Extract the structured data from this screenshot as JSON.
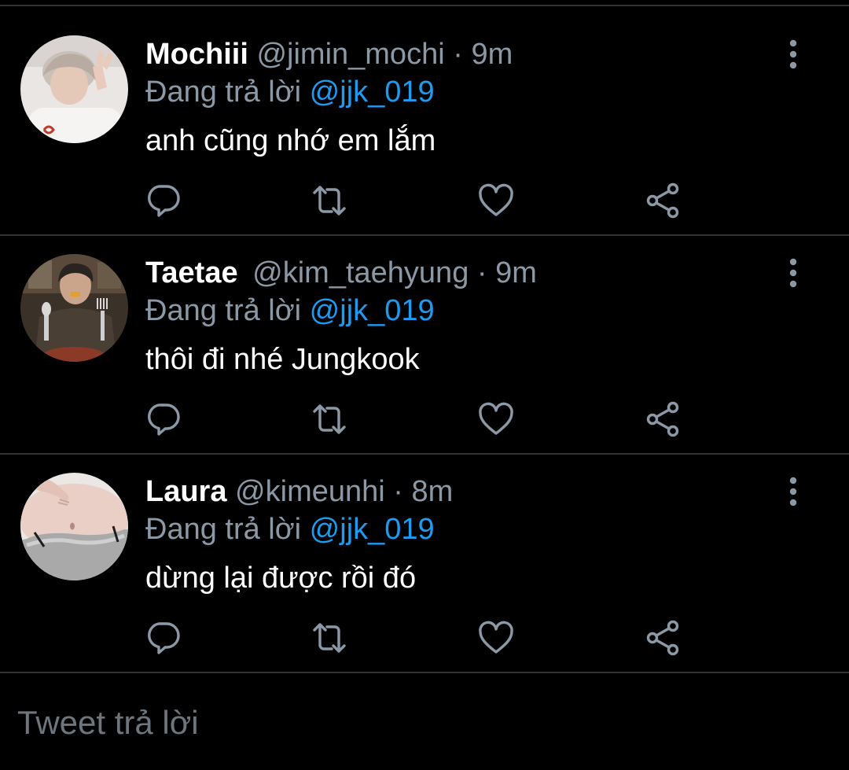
{
  "theme": {
    "background": "#000000",
    "divider": "#2f3336",
    "muted_text": "#8b98a5",
    "accent": "#1d9bf0",
    "primary_text": "#ffffff"
  },
  "tweets": [
    {
      "name": "Mochiii",
      "handle": "@jimin_mochi",
      "separator": "·",
      "time": "9m",
      "reply_prefix": "Đang trả lời",
      "reply_to": "@jjk_019",
      "text": "anh cũng nhớ em lắm",
      "avatar": "avatar-photo-peace-sign",
      "actions": [
        "reply-icon",
        "retweet-icon",
        "like-icon",
        "share-icon"
      ],
      "menu_icon": "more-vertical-icon"
    },
    {
      "name": "Taetae",
      "handle": "@kim_taehyung",
      "separator": "·",
      "time": "9m",
      "reply_prefix": "Đang trả lời",
      "reply_to": "@jjk_019",
      "text": "thôi đi nhé Jungkook",
      "avatar": "avatar-photo-fork-knife",
      "actions": [
        "reply-icon",
        "retweet-icon",
        "like-icon",
        "share-icon"
      ],
      "menu_icon": "more-vertical-icon"
    },
    {
      "name": "Laura",
      "handle": "@kimeunhi",
      "separator": "·",
      "time": "8m",
      "reply_prefix": "Đang trả lời",
      "reply_to": "@jjk_019",
      "text": "dừng lại được rồi đó",
      "avatar": "avatar-photo-waist",
      "actions": [
        "reply-icon",
        "retweet-icon",
        "like-icon",
        "share-icon"
      ],
      "menu_icon": "more-vertical-icon"
    }
  ],
  "compose": {
    "placeholder": "Tweet trả lời"
  }
}
